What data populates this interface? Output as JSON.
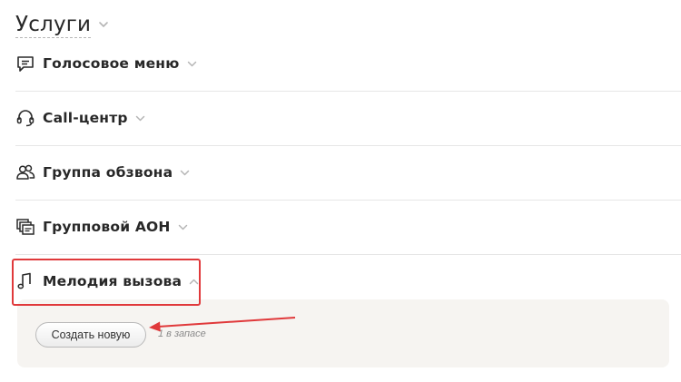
{
  "header": {
    "title": "Услуги"
  },
  "sections": [
    {
      "label": "Голосовое меню",
      "icon": "chat-icon",
      "expanded": false
    },
    {
      "label": "Call-центр",
      "icon": "headset-icon",
      "expanded": false
    },
    {
      "label": "Группа обзвона",
      "icon": "users-icon",
      "expanded": false
    },
    {
      "label": "Групповой АОН",
      "icon": "caller-id-icon",
      "expanded": false
    },
    {
      "label": "Мелодия вызова",
      "icon": "music-note-icon",
      "expanded": true
    }
  ],
  "ringtone_panel": {
    "create_button_label": "Создать новую",
    "stock_text": "1 в запасе"
  },
  "colors": {
    "highlight": "#e0393b",
    "panel_bg": "#f6f4f1",
    "divider": "#e6e6e6",
    "chevron": "#b5b5b5"
  }
}
